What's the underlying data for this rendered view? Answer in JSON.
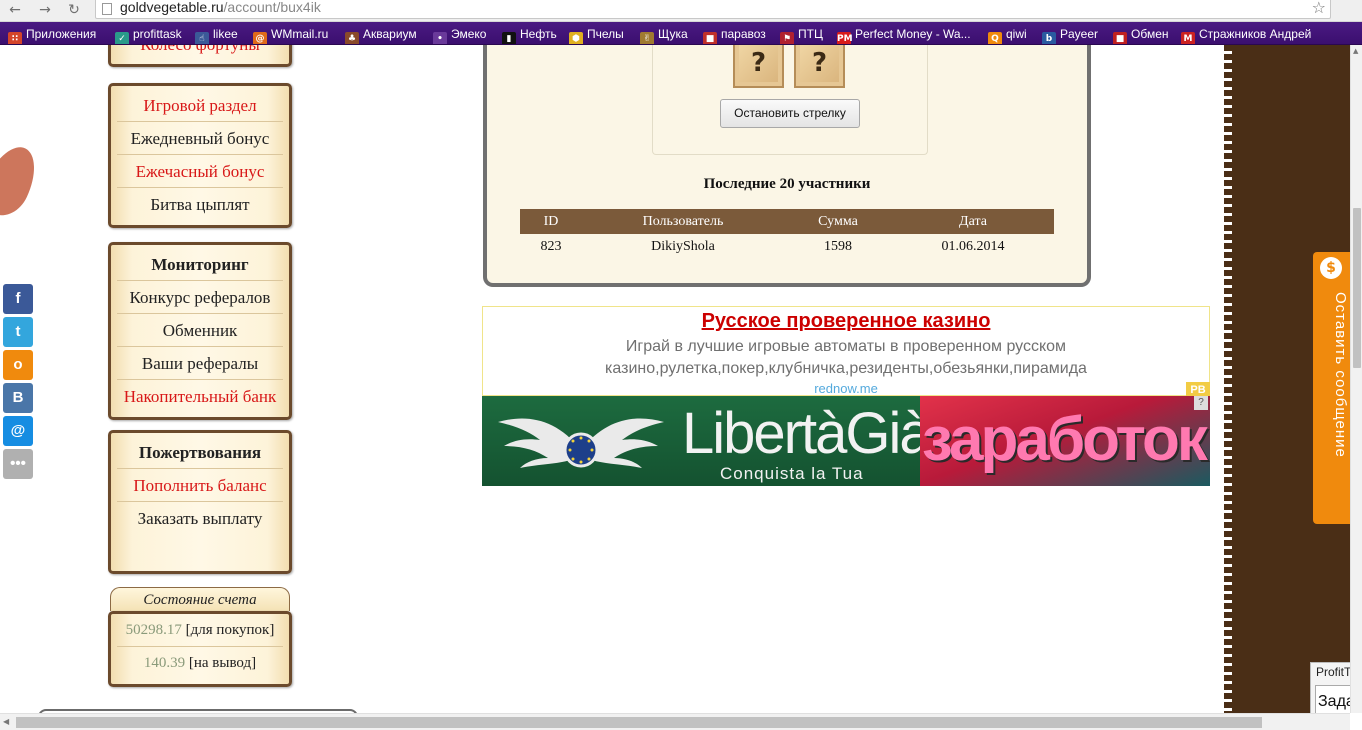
{
  "browser": {
    "url_domain": "goldvegetable.ru",
    "url_path": "/account/bux4ik",
    "back_icon": "←",
    "forward_icon": "→",
    "reload_icon": "↻",
    "star_icon": "☆",
    "bookmarks": [
      {
        "label": "Приложения",
        "icon": "apps-grid-icon",
        "color": "#d4452a",
        "glyph": "∷"
      },
      {
        "label": "profittask",
        "icon": "profittask-icon",
        "color": "#2a9a8a",
        "glyph": "✓"
      },
      {
        "label": "likee",
        "icon": "thumbs-up-icon",
        "color": "#3b5998",
        "glyph": "☝"
      },
      {
        "label": "WMmail.ru",
        "icon": "wmmail-icon",
        "color": "#e06a1a",
        "glyph": "@"
      },
      {
        "label": "Аквариум",
        "icon": "aquarium-icon",
        "color": "#8a4a2a",
        "glyph": "♣"
      },
      {
        "label": "Эмеко",
        "icon": "emeko-icon",
        "color": "#6a3a9a",
        "glyph": "•"
      },
      {
        "label": "Нефть",
        "icon": "oil-icon",
        "color": "#111111",
        "glyph": "▮"
      },
      {
        "label": "Пчелы",
        "icon": "bee-icon",
        "color": "#e0b020",
        "glyph": "⬢"
      },
      {
        "label": "Щука",
        "icon": "pike-icon",
        "color": "#a07a30",
        "glyph": "✌"
      },
      {
        "label": "паравоз",
        "icon": "locomotive-icon",
        "color": "#c0302a",
        "glyph": "■"
      },
      {
        "label": "ПТЦ",
        "icon": "ptc-icon",
        "color": "#b02030",
        "glyph": "⚑"
      },
      {
        "label": "Perfect Money - Wa...",
        "icon": "perfect-money-icon",
        "color": "#d81b1b",
        "glyph": "PM"
      },
      {
        "label": "qiwi",
        "icon": "qiwi-icon",
        "color": "#f08a0d",
        "glyph": "Q"
      },
      {
        "label": "Payeer",
        "icon": "payeer-icon",
        "color": "#2a5aa0",
        "glyph": "b"
      },
      {
        "label": "Обмен",
        "icon": "exchange-icon",
        "color": "#c02020",
        "glyph": "■"
      },
      {
        "label": "Стражников Андрей",
        "icon": "mail-m-icon",
        "color": "#cc2222",
        "glyph": "M"
      }
    ]
  },
  "social": [
    {
      "name": "facebook-icon",
      "glyph": "f",
      "color": "#3b5998"
    },
    {
      "name": "twitter-icon",
      "glyph": "t",
      "color": "#33a6dd"
    },
    {
      "name": "odnoklassniki-icon",
      "glyph": "o",
      "color": "#f08a0d"
    },
    {
      "name": "vkontakte-icon",
      "glyph": "B",
      "color": "#4a76a8"
    },
    {
      "name": "mailru-icon",
      "glyph": "@",
      "color": "#168de2"
    },
    {
      "name": "more-share-icon",
      "glyph": "•••",
      "color": "#b0b0b0"
    }
  ],
  "menu": {
    "top_partial": "Колесо фортуны",
    "game_section": [
      "Игровой раздел",
      "Ежедневный бонус",
      "Ежечасный бонус",
      "Битва цыплят"
    ],
    "monitoring": [
      "Мониторинг",
      "Конкурс рефералов",
      "Обменник",
      "Ваши рефералы",
      "Накопительный банк"
    ],
    "donations": [
      "Пожертвования",
      "Пополнить баланс",
      "Заказать выплату"
    ]
  },
  "account": {
    "title": "Состояние счета",
    "purchase_amount": "50298.17",
    "purchase_label": "[для покупок]",
    "withdraw_amount": "140.39",
    "withdraw_label": "[на вывод]"
  },
  "game": {
    "crate_symbol": "?",
    "stop_button": "Остановить стрелку",
    "last_title": "Последние 20 участники",
    "columns": [
      "ID",
      "Пользователь",
      "Сумма",
      "Дата"
    ],
    "rows": [
      [
        "823",
        "DikiyShola",
        "1598",
        "01.06.2014"
      ]
    ]
  },
  "ad": {
    "title": "Русское проверенное казино",
    "text": "Играй в лучшие игровые автоматы в проверенном русском казино,рулетка,покер,клубничка,резиденты,обезьянки,пирамида",
    "domain": "rednow.me",
    "badge": "РВ"
  },
  "banner": {
    "brand": "LibertàGià",
    "tagline": "Conquista la Tua",
    "right_text": "заработок",
    "info": "?"
  },
  "feedback": {
    "icon": "$",
    "text": "Оставить сообщение"
  },
  "profittask": {
    "title": "ProfitTask",
    "task": "Зада"
  }
}
